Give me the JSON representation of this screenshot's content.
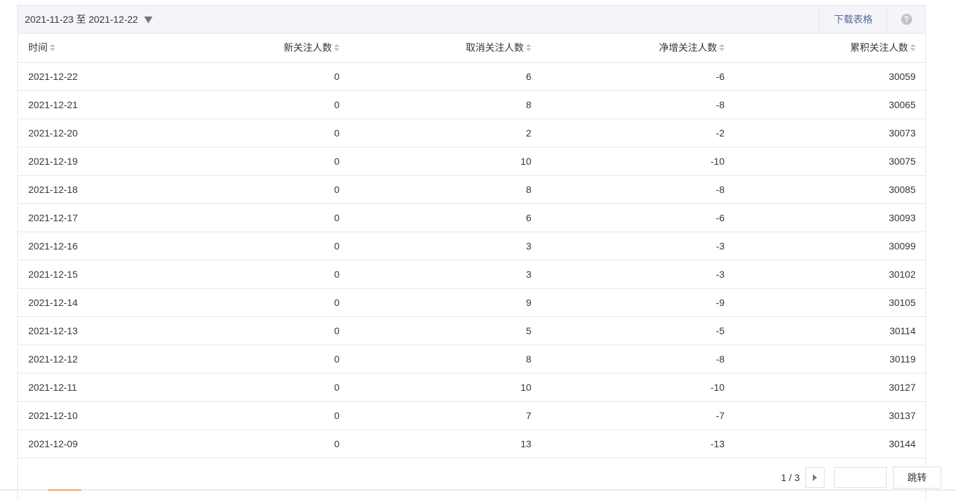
{
  "toolbar": {
    "date_range": "2021-11-23 至 2021-12-22",
    "download_label": "下载表格",
    "help_glyph": "?"
  },
  "table": {
    "headers": [
      "时间",
      "新关注人数",
      "取消关注人数",
      "净增关注人数",
      "累积关注人数"
    ],
    "rows": [
      [
        "2021-12-22",
        "0",
        "6",
        "-6",
        "30059"
      ],
      [
        "2021-12-21",
        "0",
        "8",
        "-8",
        "30065"
      ],
      [
        "2021-12-20",
        "0",
        "2",
        "-2",
        "30073"
      ],
      [
        "2021-12-19",
        "0",
        "10",
        "-10",
        "30075"
      ],
      [
        "2021-12-18",
        "0",
        "8",
        "-8",
        "30085"
      ],
      [
        "2021-12-17",
        "0",
        "6",
        "-6",
        "30093"
      ],
      [
        "2021-12-16",
        "0",
        "3",
        "-3",
        "30099"
      ],
      [
        "2021-12-15",
        "0",
        "3",
        "-3",
        "30102"
      ],
      [
        "2021-12-14",
        "0",
        "9",
        "-9",
        "30105"
      ],
      [
        "2021-12-13",
        "0",
        "5",
        "-5",
        "30114"
      ],
      [
        "2021-12-12",
        "0",
        "8",
        "-8",
        "30119"
      ],
      [
        "2021-12-11",
        "0",
        "10",
        "-10",
        "30127"
      ],
      [
        "2021-12-10",
        "0",
        "7",
        "-7",
        "30137"
      ],
      [
        "2021-12-09",
        "0",
        "13",
        "-13",
        "30144"
      ]
    ]
  },
  "pager": {
    "page_info": "1 / 3",
    "jump_value": "",
    "jump_label": "跳转"
  },
  "icons": {
    "dropdown": "caret-down-icon",
    "sort": "sort-icon",
    "help": "help-icon",
    "next": "chevron-right-icon"
  },
  "colors": {
    "link": "#576b95",
    "header_bg": "#f4f5f9",
    "border": "#e7e7eb",
    "accent": "#f5a26b"
  }
}
